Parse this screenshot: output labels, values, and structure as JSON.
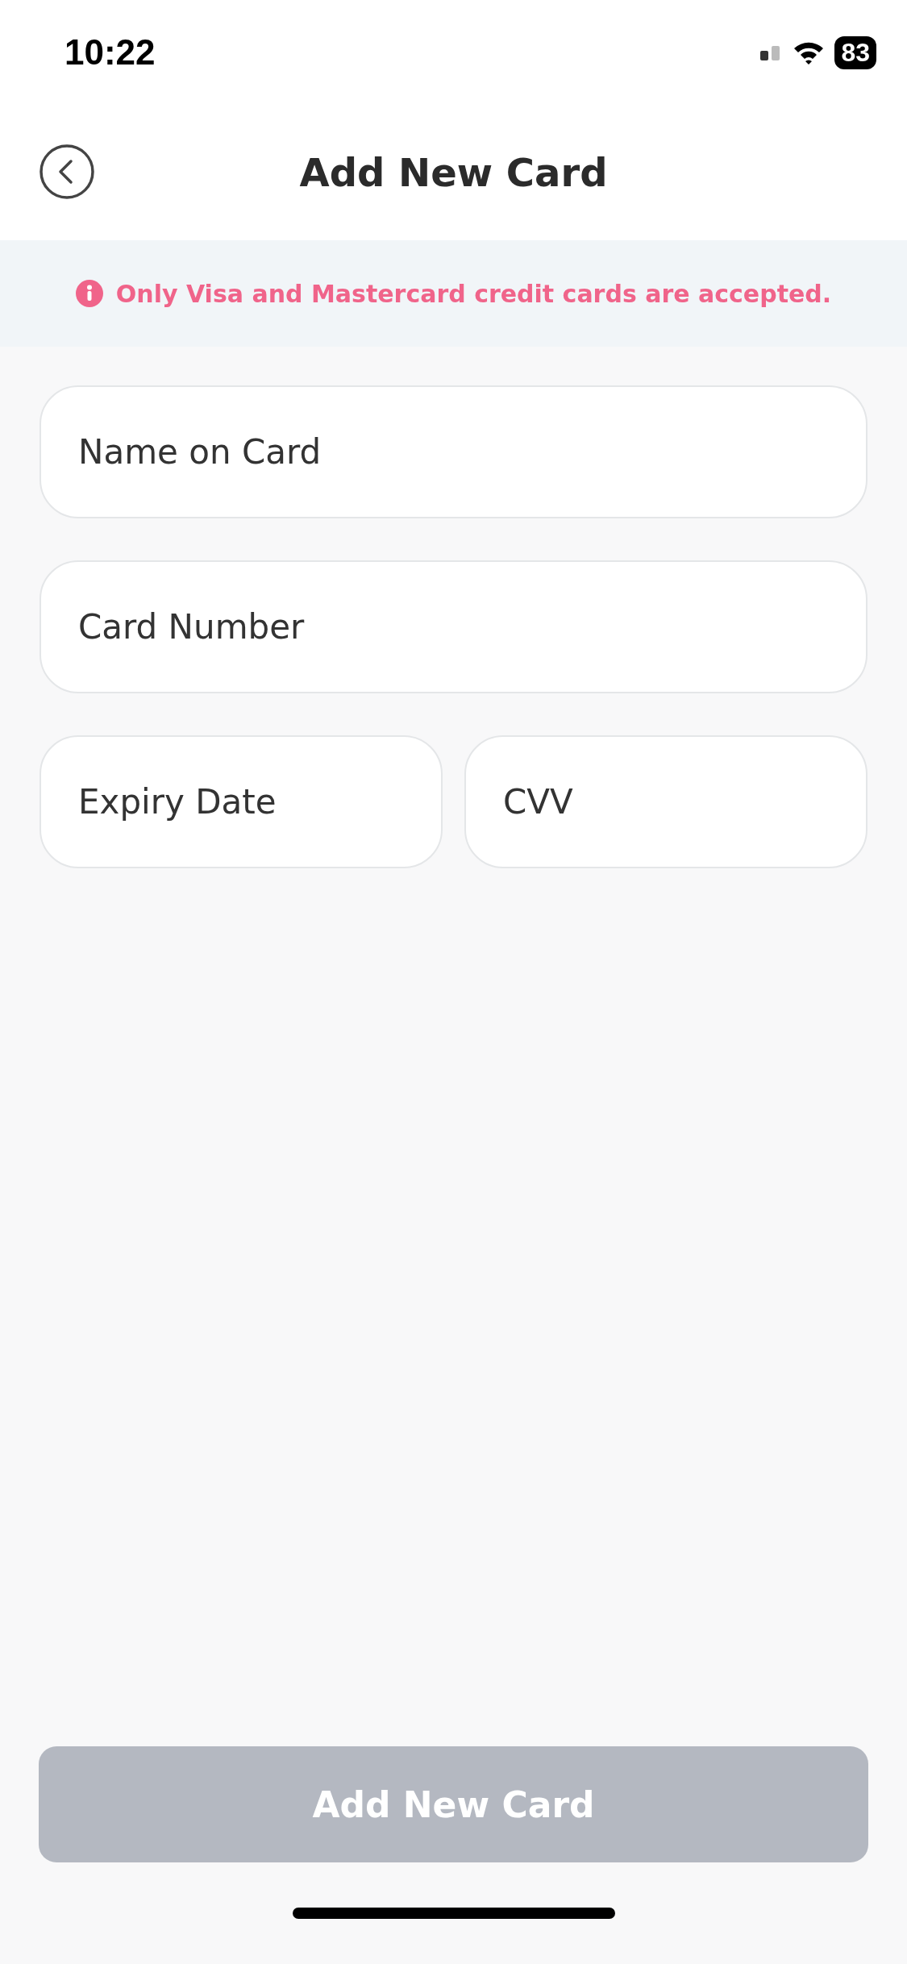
{
  "status_bar": {
    "time": "10:22",
    "battery": "83"
  },
  "header": {
    "title": "Add New Card"
  },
  "notice": {
    "text": "Only Visa and Mastercard credit cards are accepted."
  },
  "fields": [
    {
      "placeholder": "Name on Card",
      "kind": "full"
    },
    {
      "placeholder": "Card Number",
      "kind": "full"
    },
    {
      "placeholder": "Expiry Date",
      "kind": "half"
    },
    {
      "placeholder": "CVV",
      "kind": "half"
    }
  ],
  "submit_button": {
    "label": "Add New Card",
    "disabled": true
  }
}
